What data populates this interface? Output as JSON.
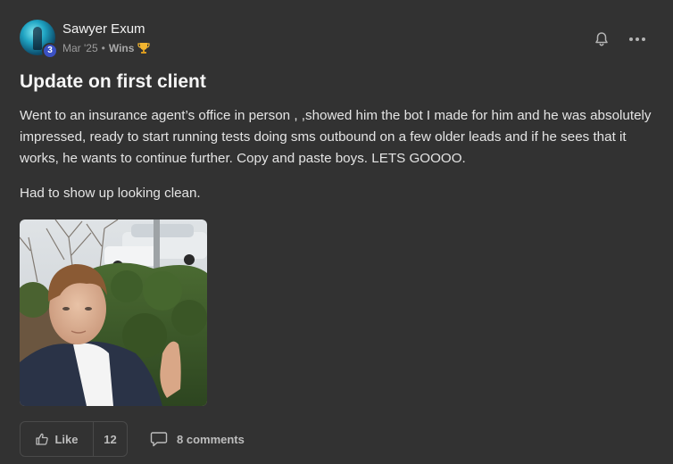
{
  "post": {
    "author": {
      "name": "Sawyer Exum",
      "level": "3"
    },
    "meta": {
      "date": "Mar '25",
      "separator": "•",
      "category": "Wins",
      "category_icon": "trophy-icon"
    },
    "title": "Update on first client",
    "body_paragraph_1": "Went to an insurance agent’s office in person , ,showed him the bot I made for him and he was absolutely impressed, ready to start running tests doing sms outbound on a few older leads and if he sees that it works, he wants to continue further. Copy and paste boys. LETS GOOOO.",
    "body_paragraph_2": "Had to show up looking clean.",
    "header_actions": [
      "bell-icon",
      "more-options-icon"
    ]
  },
  "footer": {
    "like_label": "Like",
    "like_count": "12",
    "comments_label": "8 comments"
  },
  "colors": {
    "background": "#323232",
    "text_primary": "#f2f2f2",
    "text_muted": "#9c9c9c",
    "level_badge": "#3b51c4",
    "border": "#4a4a4a"
  }
}
